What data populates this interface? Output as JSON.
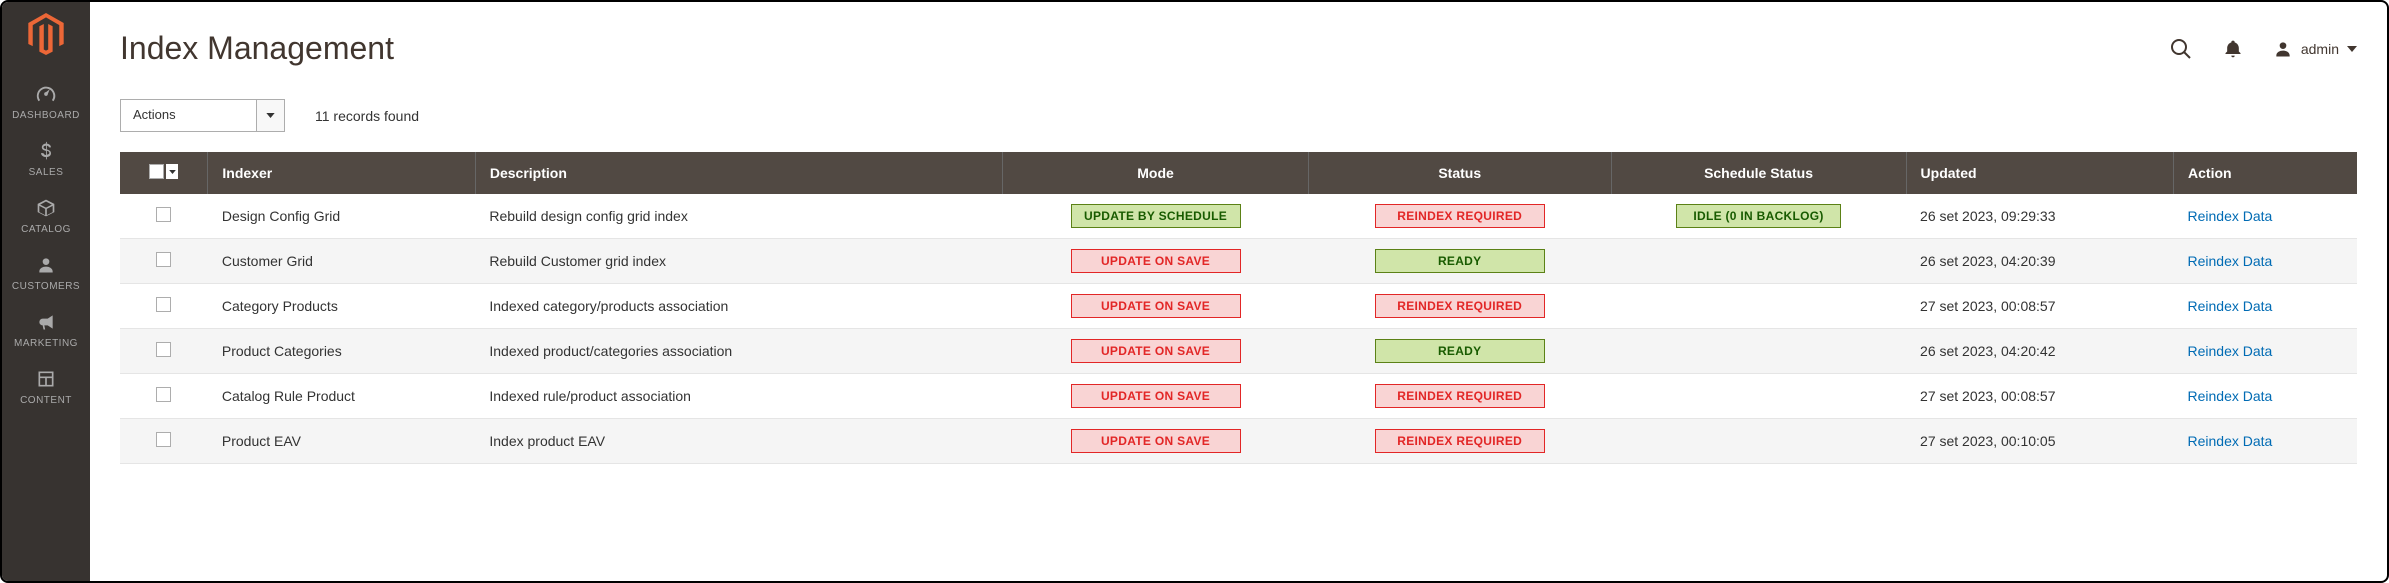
{
  "sidebar": {
    "items": [
      {
        "label": "DASHBOARD"
      },
      {
        "label": "SALES"
      },
      {
        "label": "CATALOG"
      },
      {
        "label": "CUSTOMERS"
      },
      {
        "label": "MARKETING"
      },
      {
        "label": "CONTENT"
      }
    ]
  },
  "header": {
    "title": "Index Management",
    "user": "admin"
  },
  "toolbar": {
    "actions_label": "Actions",
    "records_text": "11 records found"
  },
  "table": {
    "headers": {
      "indexer": "Indexer",
      "description": "Description",
      "mode": "Mode",
      "status": "Status",
      "schedule": "Schedule Status",
      "updated": "Updated",
      "action": "Action"
    },
    "rows": [
      {
        "indexer": "Design Config Grid",
        "description": "Rebuild design config grid index",
        "mode": {
          "text": "UPDATE BY SCHEDULE",
          "cls": "green"
        },
        "status": {
          "text": "REINDEX REQUIRED",
          "cls": "red"
        },
        "schedule": {
          "text": "IDLE (0 IN BACKLOG)",
          "cls": "green"
        },
        "updated": "26 set 2023, 09:29:33",
        "action": "Reindex Data"
      },
      {
        "indexer": "Customer Grid",
        "description": "Rebuild Customer grid index",
        "mode": {
          "text": "UPDATE ON SAVE",
          "cls": "red"
        },
        "status": {
          "text": "READY",
          "cls": "green"
        },
        "schedule": null,
        "updated": "26 set 2023, 04:20:39",
        "action": "Reindex Data"
      },
      {
        "indexer": "Category Products",
        "description": "Indexed category/products association",
        "mode": {
          "text": "UPDATE ON SAVE",
          "cls": "red"
        },
        "status": {
          "text": "REINDEX REQUIRED",
          "cls": "red"
        },
        "schedule": null,
        "updated": "27 set 2023, 00:08:57",
        "action": "Reindex Data"
      },
      {
        "indexer": "Product Categories",
        "description": "Indexed product/categories association",
        "mode": {
          "text": "UPDATE ON SAVE",
          "cls": "red"
        },
        "status": {
          "text": "READY",
          "cls": "green"
        },
        "schedule": null,
        "updated": "26 set 2023, 04:20:42",
        "action": "Reindex Data"
      },
      {
        "indexer": "Catalog Rule Product",
        "description": "Indexed rule/product association",
        "mode": {
          "text": "UPDATE ON SAVE",
          "cls": "red"
        },
        "status": {
          "text": "REINDEX REQUIRED",
          "cls": "red"
        },
        "schedule": null,
        "updated": "27 set 2023, 00:08:57",
        "action": "Reindex Data"
      },
      {
        "indexer": "Product EAV",
        "description": "Index product EAV",
        "mode": {
          "text": "UPDATE ON SAVE",
          "cls": "red"
        },
        "status": {
          "text": "REINDEX REQUIRED",
          "cls": "red"
        },
        "schedule": null,
        "updated": "27 set 2023, 00:10:05",
        "action": "Reindex Data"
      }
    ]
  }
}
